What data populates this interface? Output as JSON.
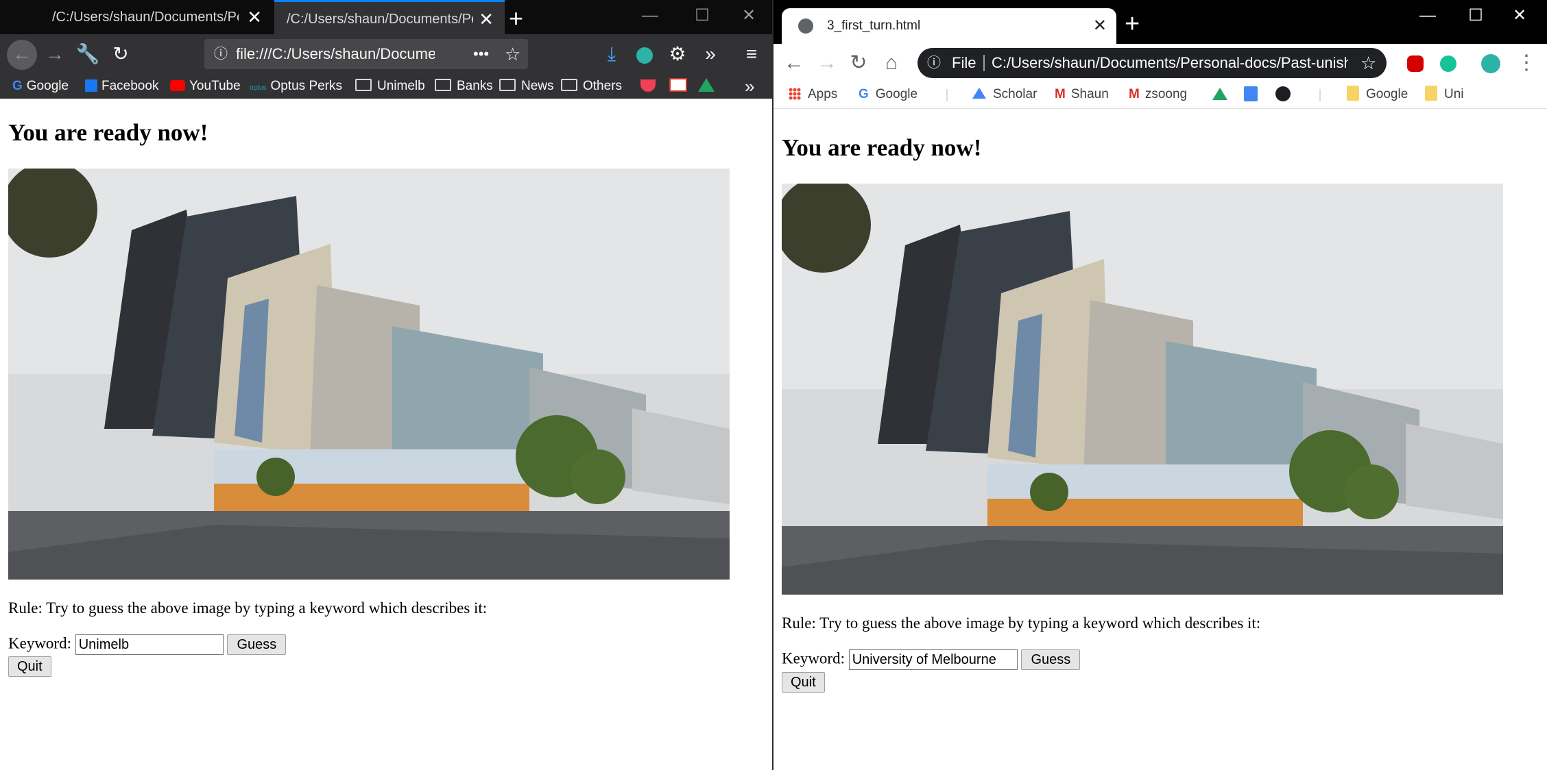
{
  "firefox": {
    "tabs": [
      {
        "label": "/C:/Users/shaun/Documents/Personal-docs"
      },
      {
        "label": "/C:/Users/shaun/Documents/Personal-docs"
      }
    ],
    "url": "file:///C:/Users/shaun/Documents/Personal-docs",
    "bookmarks": [
      "Google",
      "Facebook",
      "YouTube",
      "Optus Perks"
    ],
    "folders": [
      "Unimelb",
      "Banks",
      "News",
      "Others"
    ]
  },
  "chrome": {
    "tab_title": "3_first_turn.html",
    "url_prefix": "File",
    "url": "C:/Users/shaun/Documents/Personal-docs/Past-unishi...",
    "bookmarks": [
      "Apps",
      "Google",
      "Scholar",
      "Shaun",
      "zsoong"
    ],
    "folders": [
      "Google",
      "Uni"
    ]
  },
  "page": {
    "heading": "You are ready now!",
    "rule": "Rule: Try to guess the above image by typing a keyword which describes it:",
    "keyword_label": "Keyword:",
    "guess_label": "Guess",
    "quit_label": "Quit",
    "left_keyword_value": "Unimelb",
    "right_keyword_value": "University of Melbourne"
  },
  "colors": {
    "firefox_dark": "#323234",
    "firefox_tabbar": "#0c0c0d",
    "firefox_accent": "#0a84ff",
    "chrome_omnibox": "#202124"
  }
}
